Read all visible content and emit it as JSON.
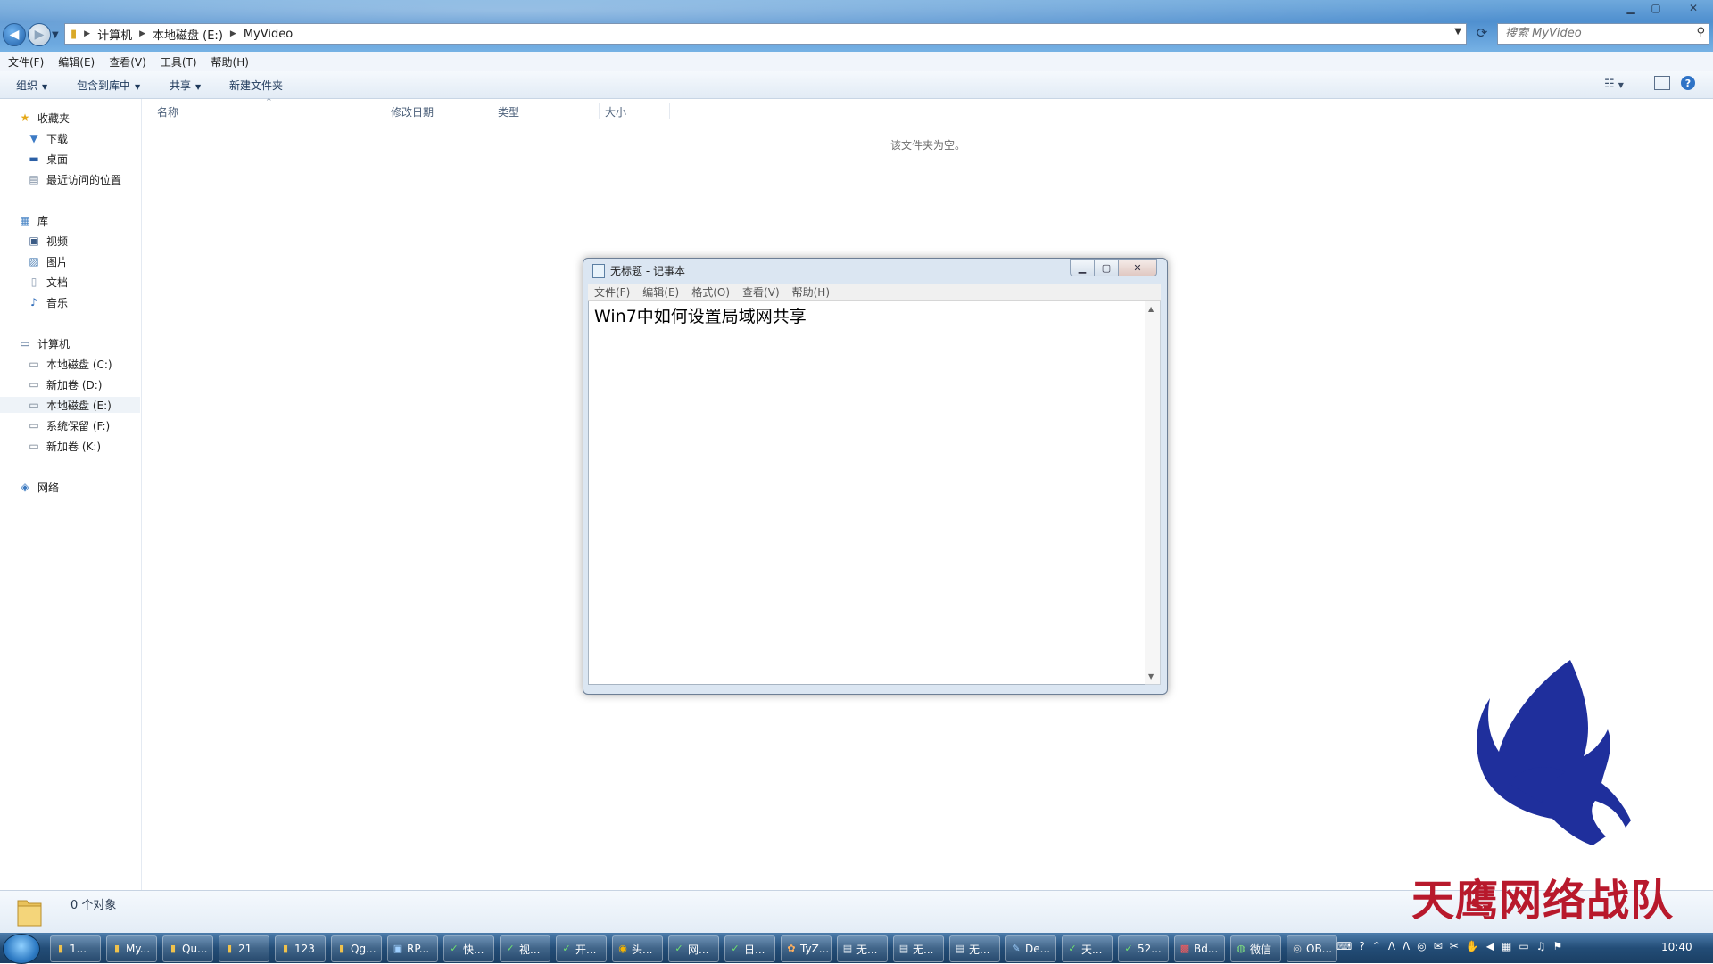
{
  "explorer": {
    "breadcrumb": [
      "计算机",
      "本地磁盘 (E:)",
      "MyVideo"
    ],
    "search_placeholder": "搜索 MyVideo",
    "menu": [
      "文件(F)",
      "编辑(E)",
      "查看(V)",
      "工具(T)",
      "帮助(H)"
    ],
    "commands": {
      "organize": "组织",
      "include_library": "包含到库中",
      "share": "共享",
      "new_folder": "新建文件夹"
    },
    "columns": [
      "名称",
      "修改日期",
      "类型",
      "大小"
    ],
    "empty_message": "该文件夹为空。",
    "status": "0 个对象"
  },
  "navpane": {
    "favorites": {
      "label": "收藏夹",
      "items": [
        "下载",
        "桌面",
        "最近访问的位置"
      ]
    },
    "libraries": {
      "label": "库",
      "items": [
        "视频",
        "图片",
        "文档",
        "音乐"
      ]
    },
    "computer": {
      "label": "计算机",
      "items": [
        "本地磁盘 (C:)",
        "新加卷 (D:)",
        "本地磁盘 (E:)",
        "系统保留 (F:)",
        "新加卷 (K:)"
      ]
    },
    "network": {
      "label": "网络"
    }
  },
  "notepad": {
    "title": "无标题 - 记事本",
    "menu": [
      "文件(F)",
      "编辑(E)",
      "格式(O)",
      "查看(V)",
      "帮助(H)"
    ],
    "content": "Win7中如何设置局域网共享"
  },
  "logo_text": "天鹰网络战队",
  "taskbar": {
    "items": [
      "1...",
      "My...",
      "Qu...",
      "21",
      "123",
      "Qg...",
      "RP...",
      "快...",
      "视...",
      "开...",
      "头...",
      "网...",
      "日...",
      "TyZ...",
      "无...",
      "无...",
      "无...",
      "De...",
      "天...",
      "52...",
      "Bd...",
      "微信",
      "OB..."
    ],
    "clock": "10:40"
  },
  "colors": {
    "logo_blue": "#1f2f9c",
    "logo_red": "#b8192c",
    "taskbar": "#234d77"
  }
}
